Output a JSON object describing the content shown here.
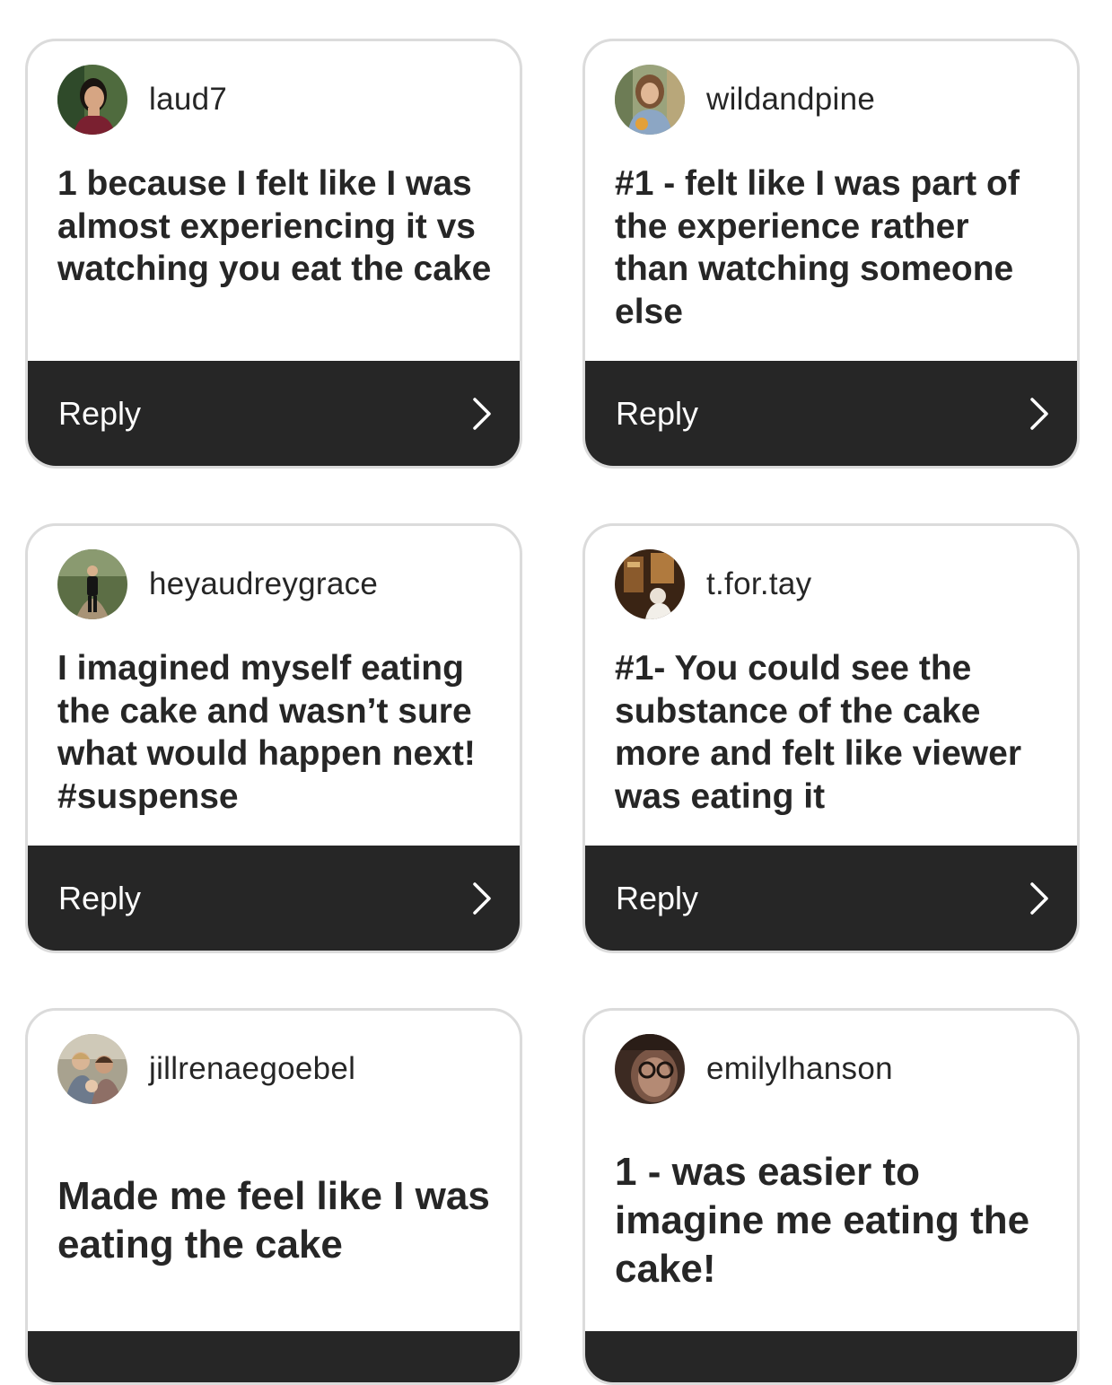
{
  "comments": [
    {
      "username": "laud7",
      "text": "1 because I felt like I was almost experiencing it vs watching you eat the cake",
      "reply_label": "Reply"
    },
    {
      "username": "wildandpine",
      "text": "#1 - felt like I was part of the experience rather than watching someone else",
      "reply_label": "Reply"
    },
    {
      "username": "heyaudreygrace",
      "text": "I imagined myself eating the cake and wasn’t sure what would happen next! #suspense",
      "reply_label": "Reply"
    },
    {
      "username": "t.for.tay",
      "text": "#1- You could see the substance of the cake more and felt like viewer was eating it",
      "reply_label": "Reply"
    },
    {
      "username": "jillrenaegoebel",
      "text": "Made me feel like I was eating the cake"
    },
    {
      "username": "emilylhanson",
      "text": "1 - was easier to imagine me eating the cake!"
    }
  ],
  "icons": {
    "reply_arrow": "chevron-right-icon"
  },
  "colors": {
    "reply_bar": "#262626",
    "card_border": "#dbdbdb",
    "text": "#262626"
  }
}
